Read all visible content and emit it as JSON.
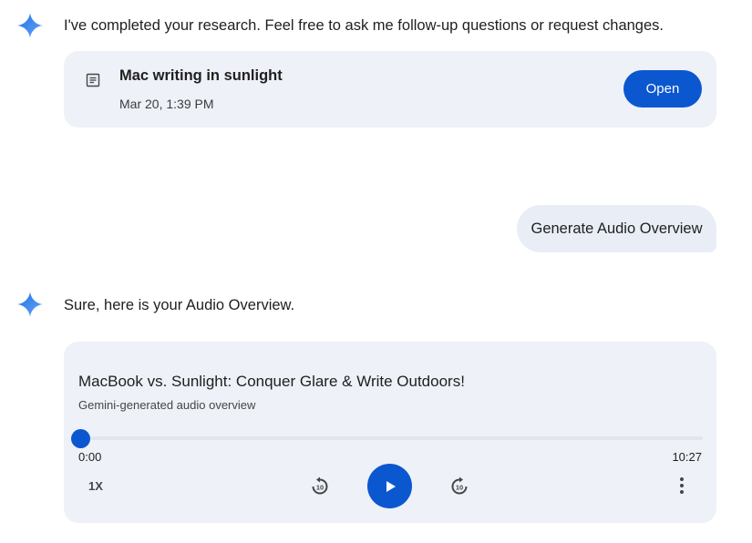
{
  "messages": {
    "research_done": "I've completed your research. Feel free to ask me follow-up questions or request changes.",
    "user_prompt": "Generate Audio Overview",
    "audio_reply": "Sure, here is your Audio Overview."
  },
  "doc_card": {
    "title": "Mac writing in sunlight",
    "date": "Mar 20, 1:39 PM",
    "open_label": "Open",
    "icon": "document-icon"
  },
  "audio_card": {
    "title": "MacBook vs. Sunlight: Conquer Glare & Write Outdoors!",
    "subtitle": "Gemini-generated audio overview",
    "current_time": "0:00",
    "duration": "10:27",
    "speed": "1X",
    "progress": 0,
    "controls": [
      "rewind-10-icon",
      "play-icon",
      "forward-10-icon",
      "more-vert-icon"
    ]
  },
  "colors": {
    "accent": "#0b57d0",
    "card_bg": "#eef1f7",
    "bubble_bg": "#e9eef6",
    "spark_start": "#4285f4",
    "spark_end": "#8ab4f8"
  }
}
